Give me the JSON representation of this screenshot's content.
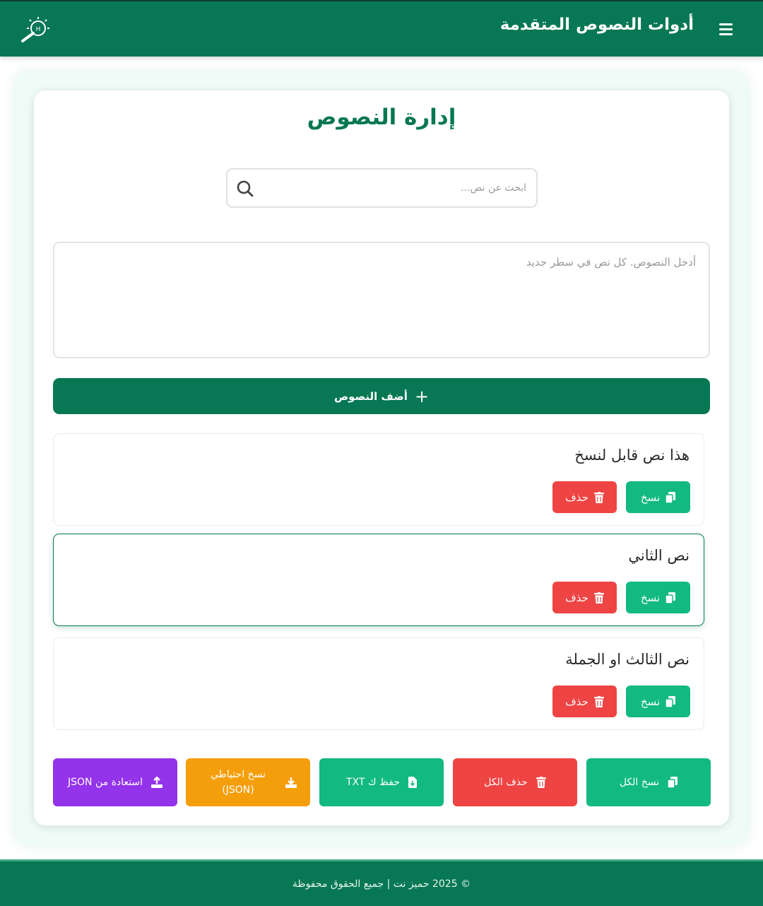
{
  "header": {
    "title": "أدوات النصوص المتقدمة",
    "icons": {
      "menu": "hamburger-menu-icon",
      "logo": "magnifier-logo-icon"
    }
  },
  "main": {
    "title": "إدارة النصوص",
    "search": {
      "placeholder": "ابحث عن نص...",
      "value": "",
      "icon": "search-icon"
    },
    "textarea": {
      "placeholder": "أدخل النصوص. كل نص في سطر جديد",
      "value": ""
    },
    "add_button": {
      "label": "أضف النصوص",
      "icon": "plus-icon"
    },
    "items": [
      {
        "text": "هذا نص قابل لنسخ",
        "copy_label": "نسخ",
        "delete_label": "حذف"
      },
      {
        "text": "نص الثاني",
        "copy_label": "نسخ",
        "delete_label": "حذف"
      },
      {
        "text": "نص الثالث او الجملة",
        "copy_label": "نسخ",
        "delete_label": "حذف"
      }
    ],
    "actions": {
      "copy_all": "نسخ الكل",
      "delete_all": "حذف الكل",
      "save_txt": "حفظ ك TXT",
      "backup_json": "نسخ احتياطي (JSON)",
      "restore_json": "استعادة من JSON"
    }
  },
  "footer": {
    "text": "© 2025 حميز نت | جميع الحقوق محفوظة"
  },
  "colors": {
    "primary": "#077754",
    "copy": "#12b981",
    "delete": "#ef4444",
    "backup": "#f59e0b",
    "restore": "#9333ea"
  }
}
